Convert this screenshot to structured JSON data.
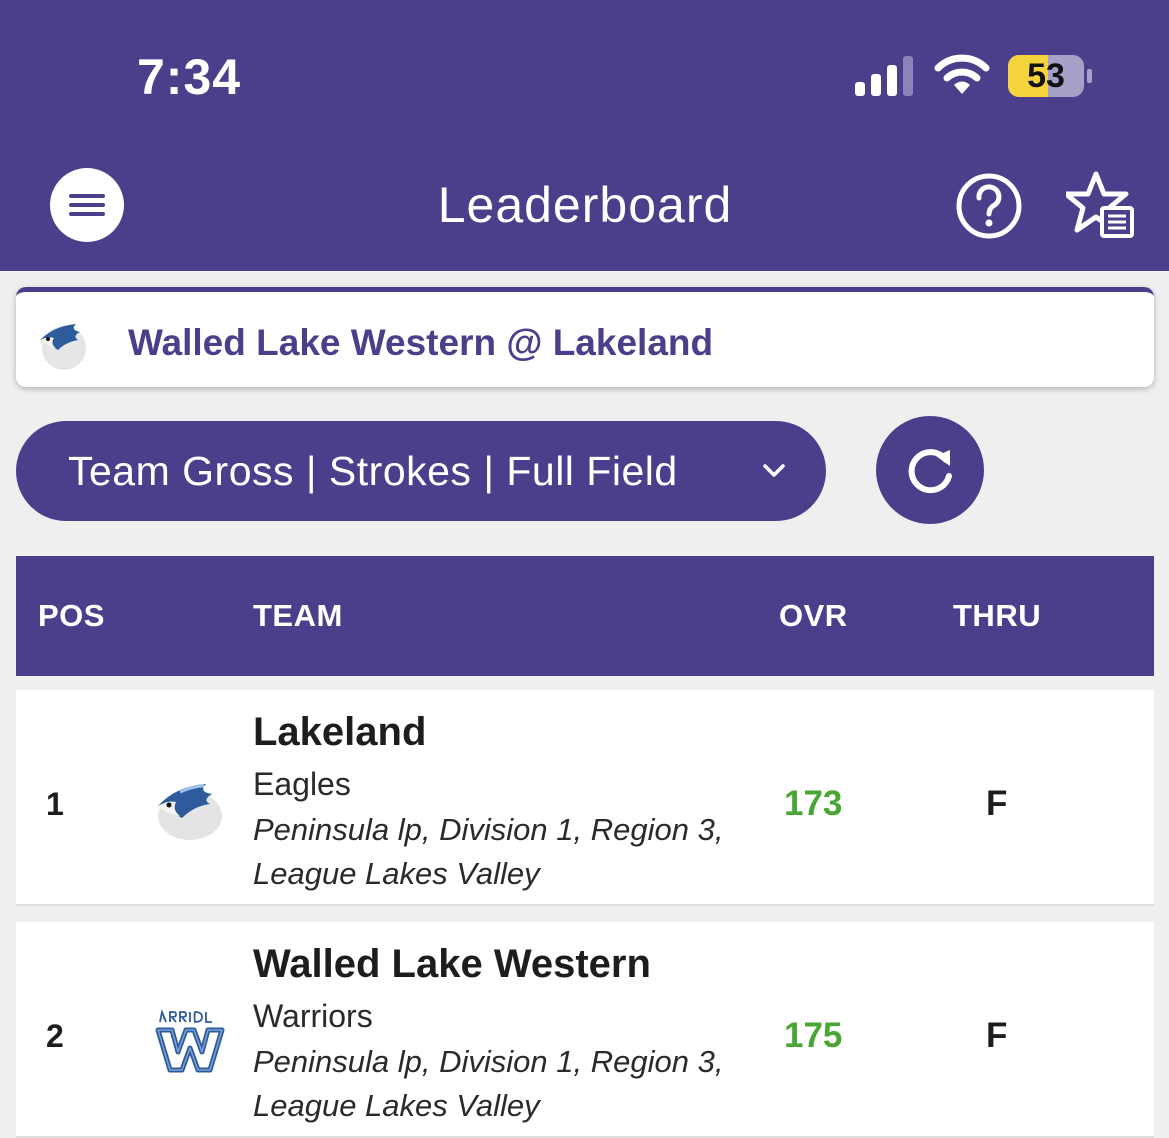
{
  "status_bar": {
    "time": "7:34",
    "battery": "53"
  },
  "header": {
    "title": "Leaderboard"
  },
  "event": {
    "title": "Walled Lake Western @ Lakeland"
  },
  "filter": {
    "selected": "Team Gross | Strokes | Full Field"
  },
  "table": {
    "columns": [
      "POS",
      "TEAM",
      "OVR",
      "THRU"
    ],
    "rows": [
      {
        "pos": "1",
        "team": "Lakeland",
        "nickname": "Eagles",
        "meta": "Peninsula lp, Division 1, Region 3, League Lakes Valley",
        "ovr": "173",
        "thru": "F"
      },
      {
        "pos": "2",
        "team": "Walled Lake Western",
        "nickname": "Warriors",
        "meta": "Peninsula lp, Division 1, Region 3, League Lakes Valley",
        "ovr": "175",
        "thru": "F"
      }
    ]
  },
  "colors": {
    "primary": "#4b3f8b",
    "score": "#4aa634",
    "battery": "#f5d33c"
  },
  "icons": [
    "menu-icon",
    "help-icon",
    "favorites-icon",
    "chevron-down-icon",
    "refresh-icon",
    "eagle-logo-icon",
    "warriors-logo-icon"
  ]
}
